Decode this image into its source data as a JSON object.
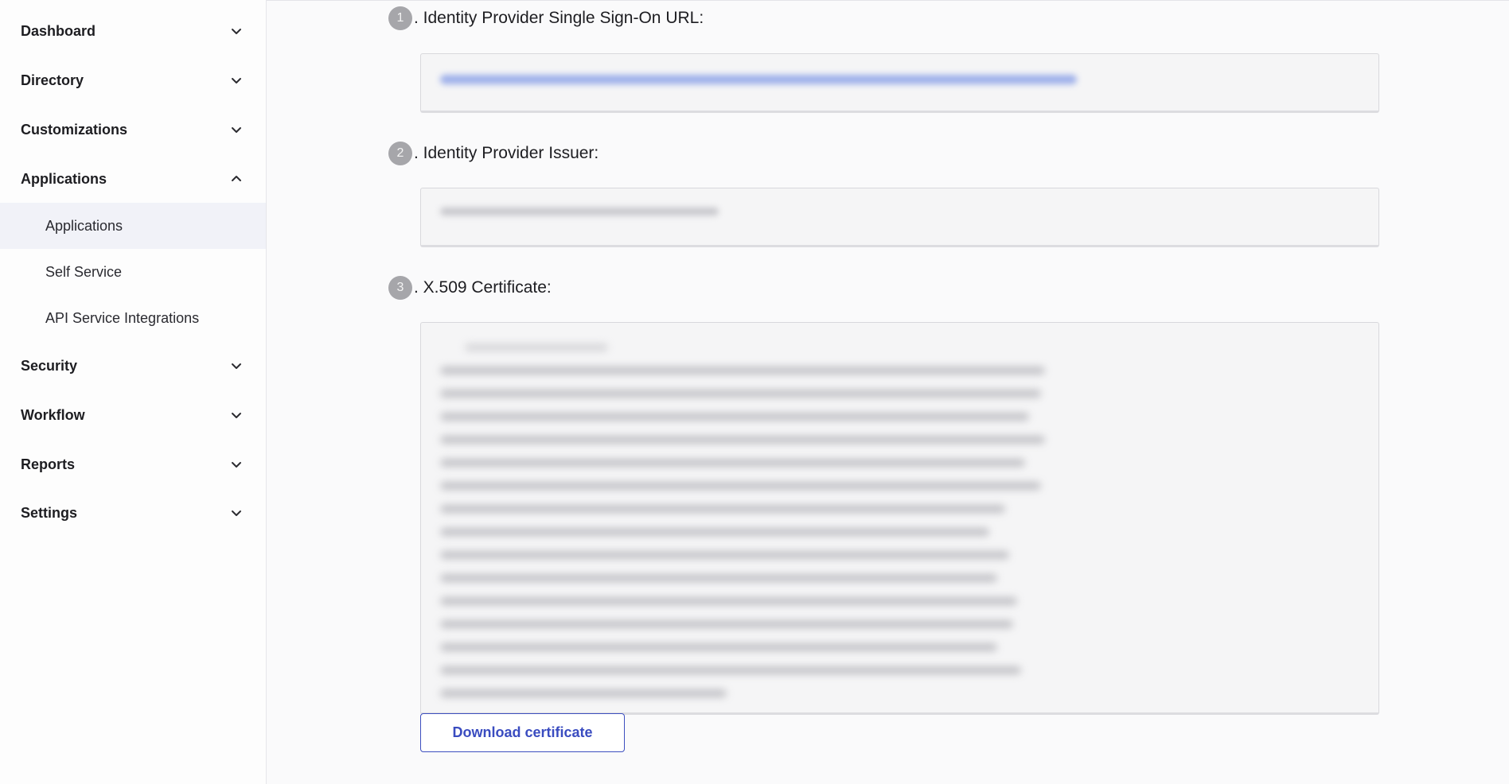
{
  "sidebar": {
    "sections": [
      {
        "label": "Dashboard",
        "chevron": "chevron-down-icon"
      },
      {
        "label": "Directory",
        "chevron": "chevron-down-icon"
      },
      {
        "label": "Customizations",
        "chevron": "chevron-down-icon"
      },
      {
        "label": "Applications",
        "chevron": "chevron-up-icon",
        "expanded": true,
        "items": [
          {
            "label": "Applications",
            "active": true
          },
          {
            "label": "Self Service"
          },
          {
            "label": "API Service Integrations"
          }
        ]
      },
      {
        "label": "Security",
        "chevron": "chevron-down-icon"
      },
      {
        "label": "Workflow",
        "chevron": "chevron-down-icon"
      },
      {
        "label": "Reports",
        "chevron": "chevron-down-icon"
      },
      {
        "label": "Settings",
        "chevron": "chevron-down-icon"
      }
    ]
  },
  "main": {
    "steps": [
      {
        "number": "1",
        "label": ". Identity Provider Single Sign-On URL:",
        "value": "(redacted)"
      },
      {
        "number": "2",
        "label": ". Identity Provider Issuer:",
        "value": "(redacted)"
      },
      {
        "number": "3",
        "label": ". X.509 Certificate:",
        "value": "(redacted)"
      }
    ],
    "download_label": "Download certificate"
  },
  "colors": {
    "accent": "#3a4cc0",
    "active_bg": "#f1f2f8",
    "step_badge": "#a6a6aa"
  }
}
